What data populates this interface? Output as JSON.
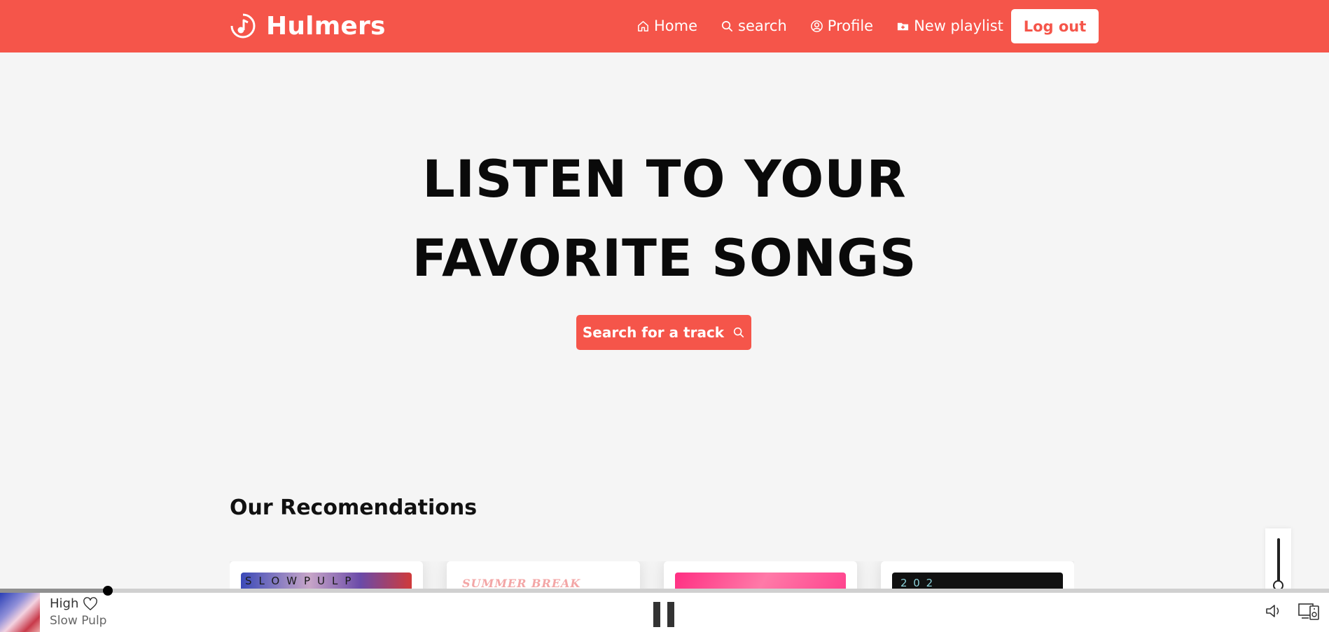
{
  "header": {
    "brand": "Hulmers",
    "nav": [
      {
        "label": "Home",
        "icon": "home-icon"
      },
      {
        "label": "search",
        "icon": "search-icon"
      },
      {
        "label": "Profile",
        "icon": "user-circle-icon"
      },
      {
        "label": "New playlist",
        "icon": "folder-plus-icon"
      }
    ],
    "logout_label": "Log out"
  },
  "hero": {
    "line1": "LISTEN TO YOUR",
    "line2": "FAVORITE SONGS",
    "cta_label": "Search for a track"
  },
  "recommendations": {
    "title": "Our Recomendations",
    "cards": [
      {
        "art_text": "SLOWPULP"
      },
      {
        "art_text": "SUMMER BREAK"
      },
      {
        "art_text": ""
      },
      {
        "art_text": "2 0 2"
      }
    ]
  },
  "player": {
    "track_title": "High",
    "artist": "Slow Pulp",
    "progress": 0.081,
    "volume": 0.0
  },
  "colors": {
    "accent": "#f5554a",
    "background": "#f5f5f5",
    "text": "#0a0a0a"
  }
}
